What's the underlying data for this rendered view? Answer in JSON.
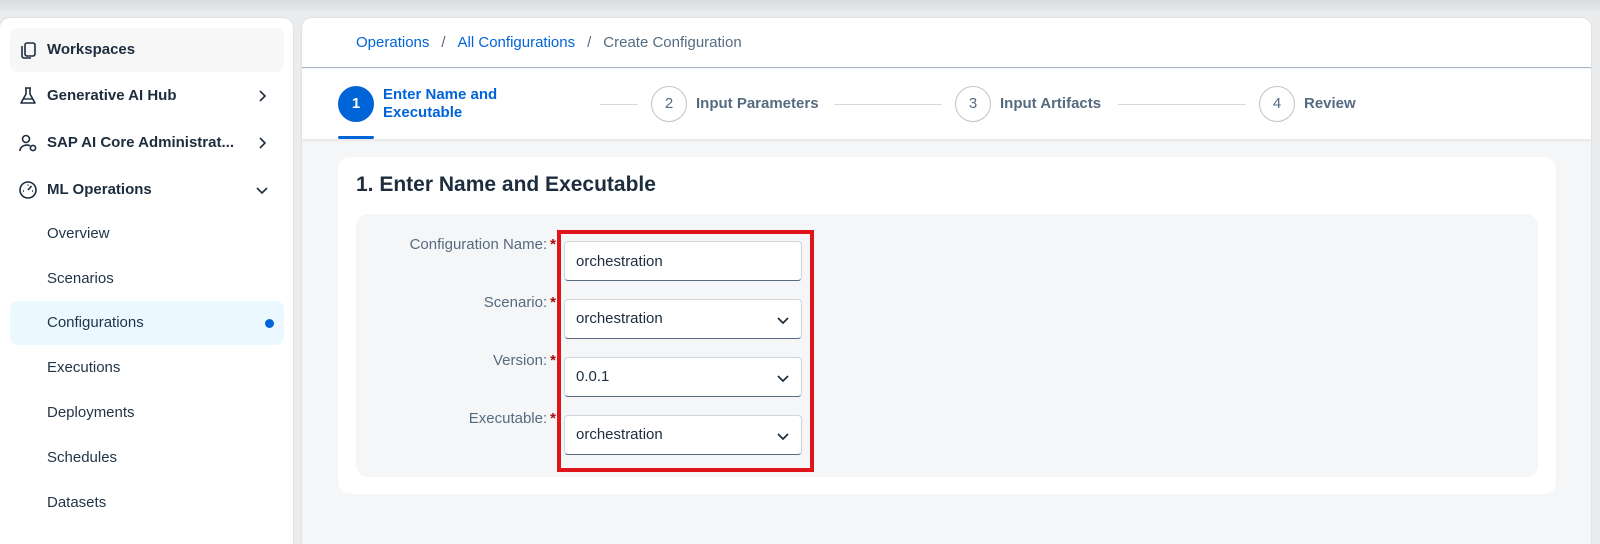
{
  "sidebar": {
    "items": [
      {
        "label": "Workspaces",
        "icon": "workspaces-icon"
      },
      {
        "label": "Generative AI Hub",
        "icon": "flask-icon"
      },
      {
        "label": "SAP AI Core Administrat...",
        "icon": "user-settings-icon"
      },
      {
        "label": "ML Operations",
        "icon": "gauge-icon"
      }
    ],
    "sub_items": [
      {
        "label": "Overview"
      },
      {
        "label": "Scenarios"
      },
      {
        "label": "Configurations",
        "selected": true
      },
      {
        "label": "Executions"
      },
      {
        "label": "Deployments"
      },
      {
        "label": "Schedules"
      },
      {
        "label": "Datasets"
      }
    ]
  },
  "breadcrumb": {
    "items": [
      "Operations",
      "All Configurations"
    ],
    "separator": "/",
    "current": "Create Configuration"
  },
  "wizard": {
    "steps": [
      {
        "number": "1",
        "label": "Enter Name and Executable",
        "active": true
      },
      {
        "number": "2",
        "label": "Input Parameters"
      },
      {
        "number": "3",
        "label": "Input Artifacts"
      },
      {
        "number": "4",
        "label": "Review"
      }
    ]
  },
  "form": {
    "title": "1. Enter Name and Executable",
    "fields": [
      {
        "label": "Configuration Name:",
        "value": "orchestration",
        "required_mark": "*"
      },
      {
        "label": "Scenario:",
        "value": "orchestration",
        "required_mark": "*"
      },
      {
        "label": "Version:",
        "value": "0.0.1",
        "required_mark": "*"
      },
      {
        "label": "Executable:",
        "value": "orchestration",
        "required_mark": "*"
      }
    ]
  },
  "colors": {
    "accent": "#0064d9",
    "highlight": "#e0141b",
    "required": "#aa0808",
    "selected_bg": "#ebf8ff"
  }
}
